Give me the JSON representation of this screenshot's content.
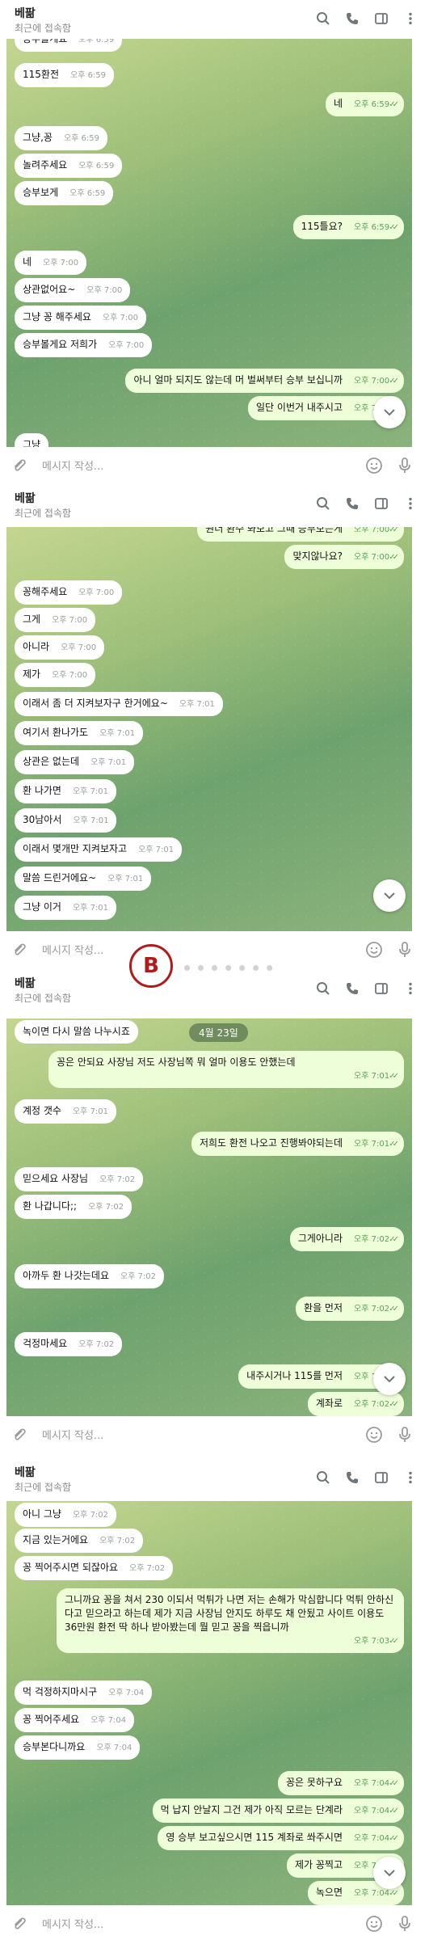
{
  "app": {
    "contact_name": "베팖",
    "status": "최근에 접속함",
    "input_placeholder": "메시지 작성..."
  },
  "panel1": {
    "messages": [
      {
        "text": "115환전",
        "time": "오후 6:59",
        "side": "in"
      },
      {
        "text": "네",
        "time": "오후 6:59",
        "side": "out"
      },
      {
        "text": "그냥,꽁",
        "time": "오후 6:59",
        "side": "in"
      },
      {
        "text": "놀려주세요",
        "time": "오후 6:59",
        "side": "in"
      },
      {
        "text": "승부보게",
        "time": "오후 6:59",
        "side": "in"
      },
      {
        "text": "115틀요?",
        "time": "오후 6:59",
        "side": "out"
      },
      {
        "text": "네",
        "time": "오후 7:00",
        "side": "in"
      },
      {
        "text": "상관없어요~",
        "time": "오후 7:00",
        "side": "in"
      },
      {
        "text": "그냥 꽁 해주세요",
        "time": "오후 7:00",
        "side": "in"
      },
      {
        "text": "승부볼게요 저희가",
        "time": "오후 7:00",
        "side": "in"
      },
      {
        "text": "아니 얼마 되지도 않는데 머 벌써부터 승부 보십니까",
        "time": "오후 7:00",
        "side": "out"
      },
      {
        "text": "일단 이번거 내주시고",
        "time": "오후 7:00",
        "side": "out"
      }
    ]
  },
  "panel2": {
    "messages": [
      {
        "text": "맞지않나요?",
        "time": "오후 7:00",
        "side": "out"
      },
      {
        "text": "꽁해주세요",
        "time": "오후 7:00",
        "side": "in"
      },
      {
        "text": "그게",
        "time": "오후 7:00",
        "side": "in"
      },
      {
        "text": "아니라",
        "time": "오후 7:00",
        "side": "in"
      },
      {
        "text": "제가",
        "time": "오후 7:00",
        "side": "in"
      },
      {
        "text": "이래서 좀 더 지켜보자구 한거에요~",
        "time": "오후 7:01",
        "side": "in"
      },
      {
        "text": "여기서 환나가도",
        "time": "오후 7:01",
        "side": "in"
      },
      {
        "text": "상관은 없는데",
        "time": "오후 7:01",
        "side": "in"
      },
      {
        "text": "환 나가면",
        "time": "오후 7:01",
        "side": "in"
      },
      {
        "text": "30남아서",
        "time": "오후 7:01",
        "side": "in"
      },
      {
        "text": "이래서 몇개만 지켜보자고",
        "time": "오후 7:01",
        "side": "in"
      },
      {
        "text": "말씀 드린거에요~",
        "time": "오후 7:01",
        "side": "in"
      },
      {
        "text": "그냥 이거",
        "time": "오후 7:01",
        "side": "in"
      }
    ]
  },
  "panel3": {
    "date_label": "4월 23일",
    "partial_top": "녹이면 다시 말씀 나누시죠",
    "messages": [
      {
        "text": "꽁은 안되요 사장님 저도 사장님쪽 뭐 얼마 이용도 안했는데",
        "time": "오후 7:01",
        "side": "out"
      },
      {
        "text": "계정 갯수",
        "time": "오후 7:01",
        "side": "in"
      },
      {
        "text": "저희도 환전 나오고 진행봐야되는데",
        "time": "오후 7:01",
        "side": "out"
      },
      {
        "text": "믿으세요 사장님",
        "time": "오후 7:02",
        "side": "in"
      },
      {
        "text": "환 나갑니다;;",
        "time": "오후 7:02",
        "side": "in"
      },
      {
        "text": "그게아니라",
        "time": "오후 7:02",
        "side": "out"
      },
      {
        "text": "아까두 환 나갓는데요",
        "time": "오후 7:02",
        "side": "in"
      },
      {
        "text": "환을 먼저",
        "time": "오후 7:02",
        "side": "out"
      },
      {
        "text": "걱정마세요",
        "time": "오후 7:02",
        "side": "in"
      },
      {
        "text": "내주시거나 115를 먼저",
        "time": "오후 7:02",
        "side": "out"
      },
      {
        "text": "계좌로",
        "time": "오후 7:02",
        "side": "out"
      }
    ]
  },
  "panel4": {
    "messages": [
      {
        "text": "아니 그냥",
        "time": "오후 7:02",
        "side": "in"
      },
      {
        "text": "지금 있는거에요",
        "time": "오후 7:02",
        "side": "in"
      },
      {
        "text": "꽁 찍어주시면 되잖아요",
        "time": "오후 7:02",
        "side": "in"
      },
      {
        "text": "그니까요 꽁을 쳐서 230 이되서 먹튀가 나면 저는 손해가 막심합니다 먹튀 안하신다고 믿으라고 하는데 제가 지금 사장님 안지도 하루도 채 안됬고 사이트 이용도 36만원 환전 딱 하나 받아봤는데 뭘 믿고 꽁을 찍읍니까",
        "time": "오후 7:03",
        "side": "out"
      },
      {
        "text": "먹 걱정하지마시구",
        "time": "오후 7:04",
        "side": "in"
      },
      {
        "text": "꽁 찍어주세요",
        "time": "오후 7:04",
        "side": "in"
      },
      {
        "text": "승부본다니까요",
        "time": "오후 7:04",
        "side": "in"
      },
      {
        "text": "꽁은 못하구요",
        "time": "오후 7:04",
        "side": "out"
      },
      {
        "text": "먹 납지 안날지 그건 제가 아직 모르는 단계라",
        "time": "오후 7:04",
        "side": "out"
      },
      {
        "text": "영 승부 보고싶으시면 115 계좌로 쏴주시면",
        "time": "오후 7:04",
        "side": "out"
      },
      {
        "text": "제가 꽁찍고",
        "time": "오후 7:04",
        "side": "out"
      },
      {
        "text": "녹으면",
        "time": "오후 7:04",
        "side": "out"
      }
    ]
  }
}
